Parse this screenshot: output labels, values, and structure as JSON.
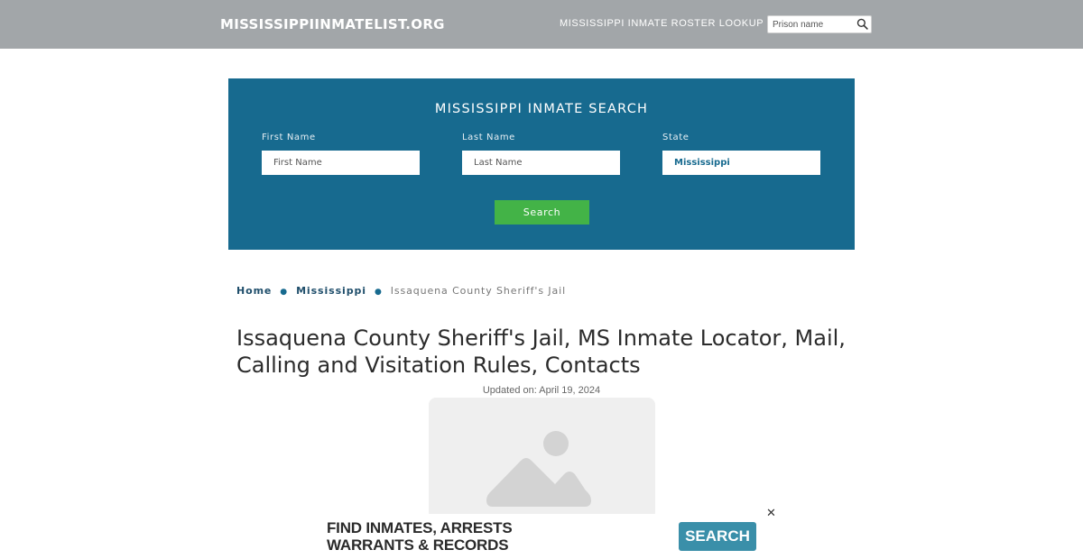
{
  "header": {
    "brand": "MISSISSIPPIINMATELIST.ORG",
    "nav_link": "MISSISSIPPI INMATE ROSTER LOOKUP",
    "prison_search_placeholder": "Prison name",
    "search_icon": "search-icon",
    "background": "#a2a6a9"
  },
  "search_panel": {
    "title": "MISSISSIPPI INMATE SEARCH",
    "first_name_label": "First Name",
    "first_name_placeholder": "First Name",
    "last_name_label": "Last Name",
    "last_name_placeholder": "Last Name",
    "state_label": "State",
    "state_value": "Mississippi",
    "button_label": "Search",
    "background": "#176a8f",
    "button_color": "#43b347"
  },
  "breadcrumb": {
    "home": "Home",
    "state": "Mississippi",
    "current": "Issaquena County Sheriff's Jail"
  },
  "page": {
    "title": "Issaquena County Sheriff's Jail, MS Inmate Locator, Mail, Calling and Visitation Rules, Contacts",
    "updated": "Updated on: April 19, 2024",
    "image_icon": "image-placeholder-icon"
  },
  "ad": {
    "line1": "FIND INMATES, ARRESTS",
    "line2": "WARRANTS & RECORDS",
    "button_label": "SEARCH",
    "close_label": "✕",
    "button_color": "#3a8fa9"
  }
}
